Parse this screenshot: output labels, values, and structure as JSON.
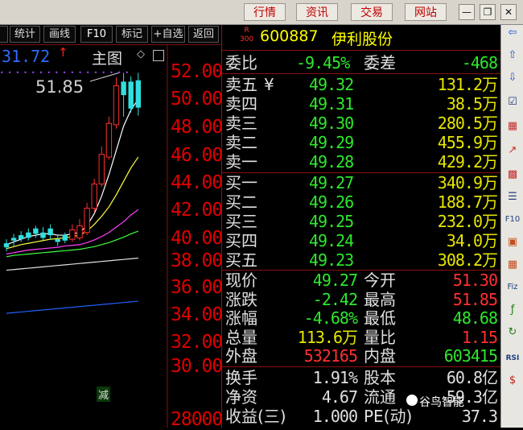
{
  "topbar": {
    "tabs": [
      "行情",
      "资讯",
      "交易",
      "网站"
    ],
    "window_controls": [
      "minimize-icon",
      "restore-icon",
      "close-icon"
    ]
  },
  "toolbar": {
    "buttons": [
      "统计",
      "画线",
      "F10",
      "标记",
      "+自选",
      "返回"
    ]
  },
  "chart": {
    "current_price": "31.72",
    "main_label": "主图",
    "high_marker": "51.85",
    "reduce_label": "减",
    "y_axis_labels": [
      "52.00",
      "50.00",
      "48.00",
      "46.00",
      "44.00",
      "42.00",
      "40.00",
      "38.00",
      "36.00",
      "34.00",
      "32.00",
      "30.00",
      "28000"
    ]
  },
  "chart_data": {
    "type": "candlestick",
    "ylim": [
      30.0,
      52.0
    ],
    "candles": [
      {
        "o": 38.9,
        "c": 39.2,
        "h": 39.5,
        "l": 38.6,
        "up": false
      },
      {
        "o": 39.4,
        "c": 39.6,
        "h": 39.9,
        "l": 39.0,
        "up": false
      },
      {
        "o": 39.5,
        "c": 39.8,
        "h": 40.1,
        "l": 39.3,
        "up": false
      },
      {
        "o": 39.6,
        "c": 40.0,
        "h": 40.3,
        "l": 39.4,
        "up": false
      },
      {
        "o": 40.3,
        "c": 39.9,
        "h": 40.5,
        "l": 39.6,
        "up": false
      },
      {
        "o": 39.6,
        "c": 40.0,
        "h": 40.4,
        "l": 39.4,
        "up": false
      },
      {
        "o": 39.8,
        "c": 40.3,
        "h": 40.6,
        "l": 39.5,
        "up": false
      },
      {
        "o": 39.3,
        "c": 39.5,
        "h": 39.8,
        "l": 39.0,
        "up": false
      },
      {
        "o": 39.4,
        "c": 39.8,
        "h": 40.0,
        "l": 39.2,
        "up": false
      },
      {
        "o": 39.5,
        "c": 40.2,
        "h": 40.6,
        "l": 39.3,
        "up": true
      },
      {
        "o": 39.6,
        "c": 40.5,
        "h": 41.0,
        "l": 39.4,
        "up": true
      },
      {
        "o": 40.0,
        "c": 41.8,
        "h": 42.2,
        "l": 39.8,
        "up": true
      },
      {
        "o": 41.8,
        "c": 43.6,
        "h": 44.0,
        "l": 41.5,
        "up": true
      },
      {
        "o": 43.6,
        "c": 45.8,
        "h": 46.4,
        "l": 43.4,
        "up": true
      },
      {
        "o": 45.6,
        "c": 48.1,
        "h": 48.6,
        "l": 45.4,
        "up": true
      },
      {
        "o": 48.0,
        "c": 50.9,
        "h": 51.5,
        "l": 47.7,
        "up": true
      },
      {
        "o": 50.2,
        "c": 51.2,
        "h": 51.85,
        "l": 48.6,
        "up": false
      },
      {
        "o": 51.2,
        "c": 49.2,
        "h": 51.6,
        "l": 48.9,
        "up": false
      },
      {
        "o": 51.3,
        "c": 49.27,
        "h": 51.85,
        "l": 48.68,
        "up": false
      }
    ],
    "ma_lines": [
      {
        "name": "MA5",
        "color": "#ffffff",
        "values": [
          39.1,
          39.3,
          39.5,
          39.7,
          39.8,
          39.9,
          39.9,
          39.8,
          39.8,
          39.9,
          40.0,
          40.5,
          41.4,
          42.7,
          44.3,
          46.1,
          47.9,
          49.1,
          49.9
        ]
      },
      {
        "name": "MA10",
        "color": "#ffff40",
        "values": [
          38.8,
          38.95,
          39.1,
          39.2,
          39.3,
          39.4,
          39.5,
          39.55,
          39.6,
          39.7,
          39.8,
          40.1,
          40.6,
          41.2,
          41.9,
          42.8,
          43.8,
          44.8,
          45.6
        ]
      },
      {
        "name": "MA20",
        "color": "#ff40ff",
        "values": [
          38.4,
          38.5,
          38.6,
          38.7,
          38.75,
          38.8,
          38.85,
          38.9,
          39.0,
          39.05,
          39.1,
          39.25,
          39.45,
          39.7,
          40.0,
          40.4,
          40.8,
          41.3,
          41.7
        ]
      },
      {
        "name": "MA30",
        "color": "#40ff40",
        "values": [
          38.2,
          38.3,
          38.35,
          38.4,
          38.45,
          38.5,
          38.55,
          38.6,
          38.65,
          38.7,
          38.75,
          38.85,
          38.95,
          39.1,
          39.25,
          39.45,
          39.65,
          39.9,
          40.1
        ]
      },
      {
        "name": "MA60",
        "color": "#e0e0e0",
        "values": [
          37.2,
          37.25,
          37.3,
          37.35,
          37.4,
          37.45,
          37.5,
          37.55,
          37.6,
          37.65,
          37.7,
          37.75,
          37.8,
          37.85,
          37.9,
          37.95,
          38.0,
          38.05,
          38.1
        ]
      },
      {
        "name": "MA120",
        "color": "#2060ff",
        "values": [
          34.0,
          34.05,
          34.1,
          34.15,
          34.2,
          34.25,
          34.3,
          34.35,
          34.4,
          34.45,
          34.5,
          34.55,
          34.6,
          34.65,
          34.7,
          34.75,
          34.8,
          34.85,
          34.9
        ]
      }
    ]
  },
  "quote": {
    "r_label": "R",
    "index_label": "300",
    "code": "600887",
    "name": "伊利股份",
    "weibi_label": "委比",
    "weibi_value": "-9.45%",
    "weicha_label": "委差",
    "weicha_value": "-468",
    "asks": [
      {
        "label": "卖五",
        "mark": "¥",
        "price": "49.32",
        "volume": "131.2万"
      },
      {
        "label": "卖四",
        "mark": "",
        "price": "49.31",
        "volume": "38.5万"
      },
      {
        "label": "卖三",
        "mark": "",
        "price": "49.30",
        "volume": "280.5万"
      },
      {
        "label": "卖二",
        "mark": "",
        "price": "49.29",
        "volume": "455.9万"
      },
      {
        "label": "卖一",
        "mark": "",
        "price": "49.28",
        "volume": "429.2万"
      }
    ],
    "bids": [
      {
        "label": "买一",
        "price": "49.27",
        "volume": "340.9万"
      },
      {
        "label": "买二",
        "price": "49.26",
        "volume": "188.7万"
      },
      {
        "label": "买三",
        "price": "49.25",
        "volume": "232.0万"
      },
      {
        "label": "买四",
        "price": "49.24",
        "volume": "34.0万"
      },
      {
        "label": "买五",
        "price": "49.23",
        "volume": "308.2万"
      }
    ],
    "stats": [
      {
        "l1": "现价",
        "v1": "49.27",
        "c1": "green",
        "l2": "今开",
        "v2": "51.30",
        "c2": "red"
      },
      {
        "l1": "涨跌",
        "v1": "-2.42",
        "c1": "green",
        "l2": "最高",
        "v2": "51.85",
        "c2": "red"
      },
      {
        "l1": "涨幅",
        "v1": "-4.68%",
        "c1": "green",
        "l2": "最低",
        "v2": "48.68",
        "c2": "green"
      },
      {
        "l1": "总量",
        "v1": "113.6万",
        "c1": "yellow",
        "l2": "量比",
        "v2": "1.15",
        "c2": "red"
      },
      {
        "l1": "外盘",
        "v1": "532165",
        "c1": "red",
        "l2": "内盘",
        "v2": "603415",
        "c2": "green"
      }
    ],
    "extra": [
      {
        "l1": "换手",
        "v1": "1.91%",
        "l2": "股本",
        "v2": "60.8亿"
      },
      {
        "l1": "净资",
        "v1": "4.67",
        "l2": "流通",
        "v2": "59.3亿"
      },
      {
        "l1": "收益(三)",
        "v1": "1.000",
        "l2": "PE(动)",
        "v2": "37.3"
      }
    ]
  },
  "watermark": "谷鸟智能",
  "colors": {
    "up": "#ff3030",
    "down": "#30e0e0",
    "accent_red": "#8a1010",
    "price_green": "#2ee82e"
  }
}
